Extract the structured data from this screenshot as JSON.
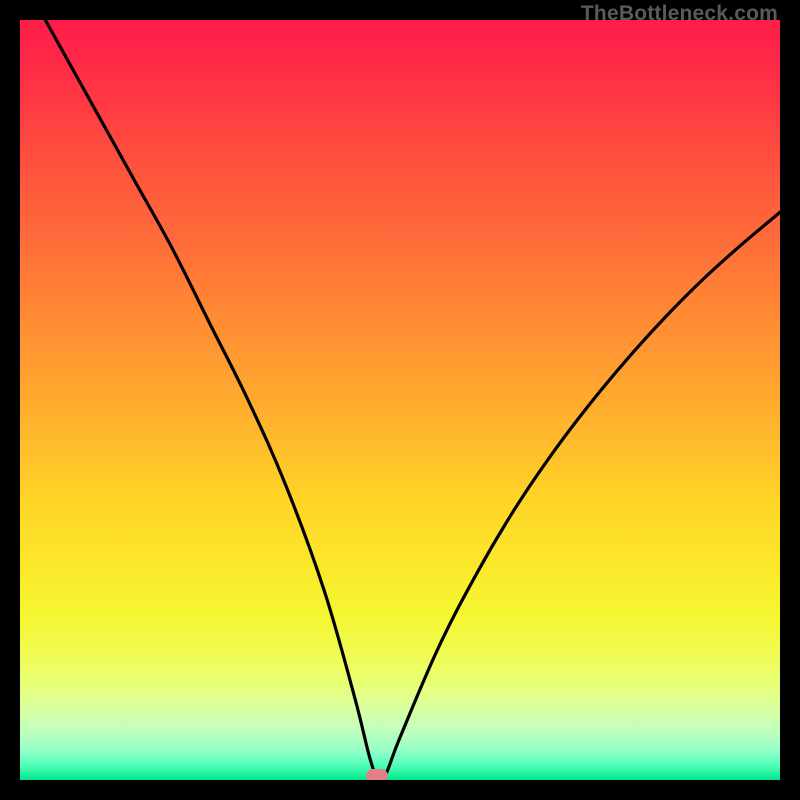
{
  "watermark": "TheBottleneck.com",
  "chart_data": {
    "type": "line",
    "title": "",
    "xlabel": "",
    "ylabel": "",
    "xlim": [
      0,
      100
    ],
    "ylim": [
      0,
      100
    ],
    "grid": false,
    "marker": {
      "x": 47.0,
      "y": 0.5
    },
    "series": [
      {
        "name": "bottleneck-curve",
        "x": [
          0,
          5,
          10,
          15,
          20,
          25,
          30,
          35,
          40,
          44,
          46,
          47,
          48,
          50,
          55,
          60,
          65,
          70,
          75,
          80,
          85,
          90,
          95,
          100
        ],
        "values": [
          106,
          97,
          88,
          79,
          70,
          60,
          50,
          38.7,
          25,
          11,
          3,
          0.5,
          0.5,
          5.6,
          17.3,
          27,
          35.5,
          42.9,
          49.5,
          55.5,
          61,
          66,
          70.5,
          74.7
        ]
      }
    ],
    "gradient_stops": [
      {
        "pos": 0.0,
        "color": "#ff1c4b"
      },
      {
        "pos": 0.28,
        "color": "#ff693a"
      },
      {
        "pos": 0.52,
        "color": "#ffb02d"
      },
      {
        "pos": 0.78,
        "color": "#f5f631"
      },
      {
        "pos": 0.93,
        "color": "#c6ffb9"
      },
      {
        "pos": 1.0,
        "color": "#00e58c"
      }
    ]
  }
}
